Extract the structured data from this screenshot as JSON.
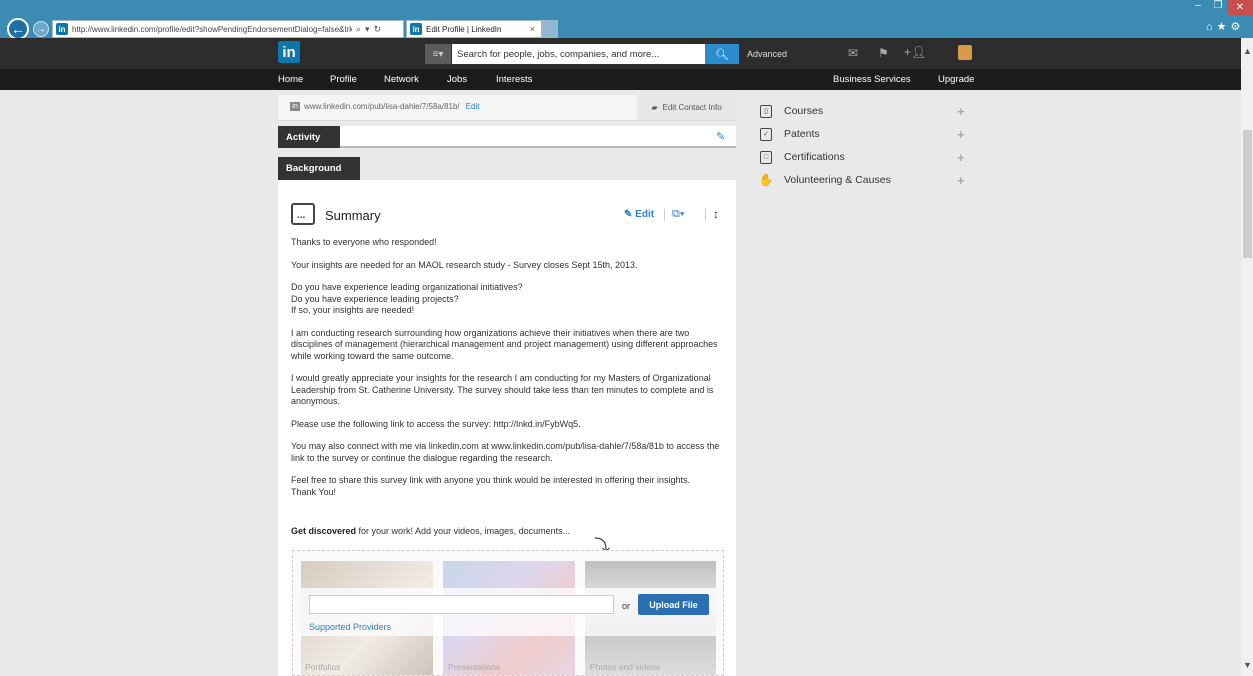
{
  "browser": {
    "url": "http://www.linkedin.com/profile/edit?showPendingEndorsementDialog=false&trk=hb_i",
    "url_domain": "linkedin.com",
    "tab_title": "Edit Profile | LinkedIn",
    "tab_close": "×",
    "back": "←",
    "forward": "→"
  },
  "linkedin": {
    "logo": "in",
    "search_placeholder": "Search for people, jobs, companies, and more...",
    "advanced": "Advanced",
    "nav": [
      "Home",
      "Profile",
      "Network",
      "Jobs",
      "Interests"
    ],
    "nav_right": [
      "Business Services",
      "Upgrade"
    ]
  },
  "contact": {
    "public_url": "www.linkedin.com/pub/lisa-dahle/7/58a/81b/",
    "edit_label": "Edit",
    "contact_info_label": "Edit Contact Info"
  },
  "sections": {
    "activity": "Activity",
    "background": "Background"
  },
  "summary": {
    "title": "Summary",
    "edit_label": "Edit",
    "paragraphs": [
      "Thanks to everyone who responded!",
      "Your insights are needed for an MAOL research study - Survey closes Sept 15th, 2013.",
      "Do you have experience leading organizational initiatives?\nDo you have experience leading projects?\nIf so, your insights are needed!",
      "I am conducting research surrounding how organizations achieve their initiatives when there are two disciplines of management (hierarchical management and project management) using different approaches while working toward the same outcome.",
      "I would greatly appreciate your insights for the research I am conducting for my Masters of Organizational Leadership from St. Catherine University. The survey should take less than ten minutes to complete and is anonymous.",
      "Please use the following link to access the survey: http://lnkd.in/FybWq5.",
      "You may also connect with me via linkedin.com at www.linkedin.com/pub/lisa-dahle/7/58a/81b to access the link to the survey or continue the dialogue regarding the research.",
      "Feel free to share this survey link with anyone you think would be interested in offering their insights.\nThank You!"
    ],
    "get_discovered_bold": "Get discovered",
    "get_discovered_rest": " for your work! Add your videos, images, documents...",
    "or_label": "or",
    "upload_label": "Upload File",
    "providers_label": "Supported Providers",
    "thumbs": [
      "Portfolios",
      "Presentations",
      "Photos and videos"
    ]
  },
  "add_sections": [
    {
      "label": "Courses",
      "icon": "courses-icon"
    },
    {
      "label": "Patents",
      "icon": "patents-icon"
    },
    {
      "label": "Certifications",
      "icon": "certifications-icon"
    },
    {
      "label": "Volunteering & Causes",
      "icon": "volunteering-icon"
    }
  ],
  "colors": {
    "linkedin_blue": "#0e76a8",
    "link_blue": "#2a7fc5",
    "header_dark": "#2d2d2d",
    "chrome_blue": "#3c8bb3"
  }
}
